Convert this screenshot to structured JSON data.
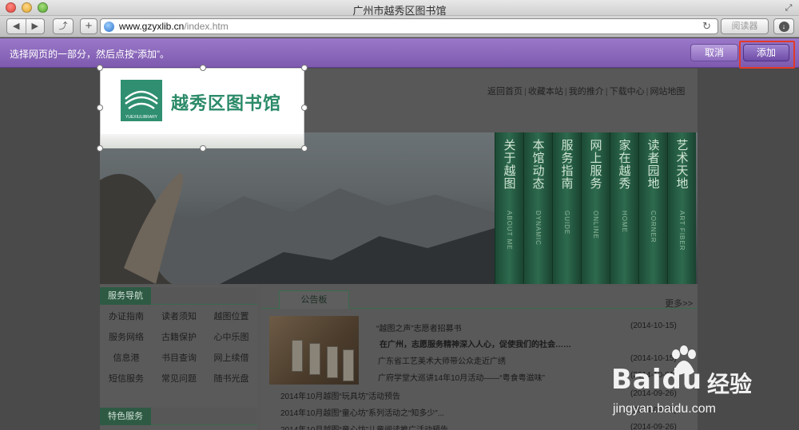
{
  "window": {
    "title": "广州市越秀区图书馆"
  },
  "toolbar": {
    "back_label": "◀",
    "forward_label": "▶",
    "share_label": "⤴",
    "add_label": "+",
    "url_host": "www.gzyxlib.cn",
    "url_path": "/index.htm",
    "reload_label": "↻",
    "reader_label": "阅读器",
    "download_label": "↓"
  },
  "clipbar": {
    "prompt": "选择网页的一部分，然后点按“添加”。",
    "cancel_label": "取消",
    "add_label": "添加"
  },
  "site": {
    "logo_text": "越秀区图书馆",
    "logo_sub": "YUEXIULIBRARY",
    "top_nav": [
      "返回首页",
      "收藏本站",
      "我的推介",
      "下载中心",
      "网站地图"
    ],
    "banner_sections": [
      {
        "cn": "关于越图",
        "en": "ABOUT ME"
      },
      {
        "cn": "本馆动态",
        "en": "DYNAMIC"
      },
      {
        "cn": "服务指南",
        "en": "GUIDE"
      },
      {
        "cn": "网上服务",
        "en": "ONLINE"
      },
      {
        "cn": "家在越秀",
        "en": "HOME"
      },
      {
        "cn": "读者园地",
        "en": "CORNER"
      },
      {
        "cn": "艺术天地",
        "en": "ART FIBER"
      }
    ],
    "service_nav_title": "服务导航",
    "service_nav_items": [
      "办证指南",
      "读者须知",
      "越图位置",
      "服务网络",
      "古籍保护",
      "心中乐图",
      "信息港",
      "书目查询",
      "网上续借",
      "短信服务",
      "常见问题",
      "随书光盘"
    ],
    "featured_title": "特色服务",
    "notice_tab": "公告板",
    "more_label": "更多>>",
    "news": [
      {
        "title": "“越图之声”志愿者招募书",
        "date": "(2014-10-15)",
        "bold": false
      },
      {
        "title": "在广州，志愿服务精神深入人心，促使我们的社会……",
        "date": "",
        "bold": true
      },
      {
        "title": "广东省工艺美术大师带公众走近广绣",
        "date": "(2014-10-15)",
        "bold": false
      },
      {
        "title": "广府学堂大巡讲14年10月活动——“粤食粤滋味”",
        "date": "(2014-10-01)",
        "bold": false
      },
      {
        "title": "2014年10月越图“玩具坊”活动预告",
        "date": "(2014-09-26)",
        "bold": false
      },
      {
        "title": "2014年10月越图“童心坊”系列活动之“知多少”...",
        "date": "(2014-09-26)",
        "bold": false
      },
      {
        "title": "2014年10月越图“童心坊”儿童阅读推广活动预告",
        "date": "(2014-09-26)",
        "bold": false
      }
    ]
  },
  "watermark": {
    "brand_a": "Bai",
    "brand_b": "du",
    "brand_cn": "经验",
    "url": "jingyan.baidu.com"
  }
}
